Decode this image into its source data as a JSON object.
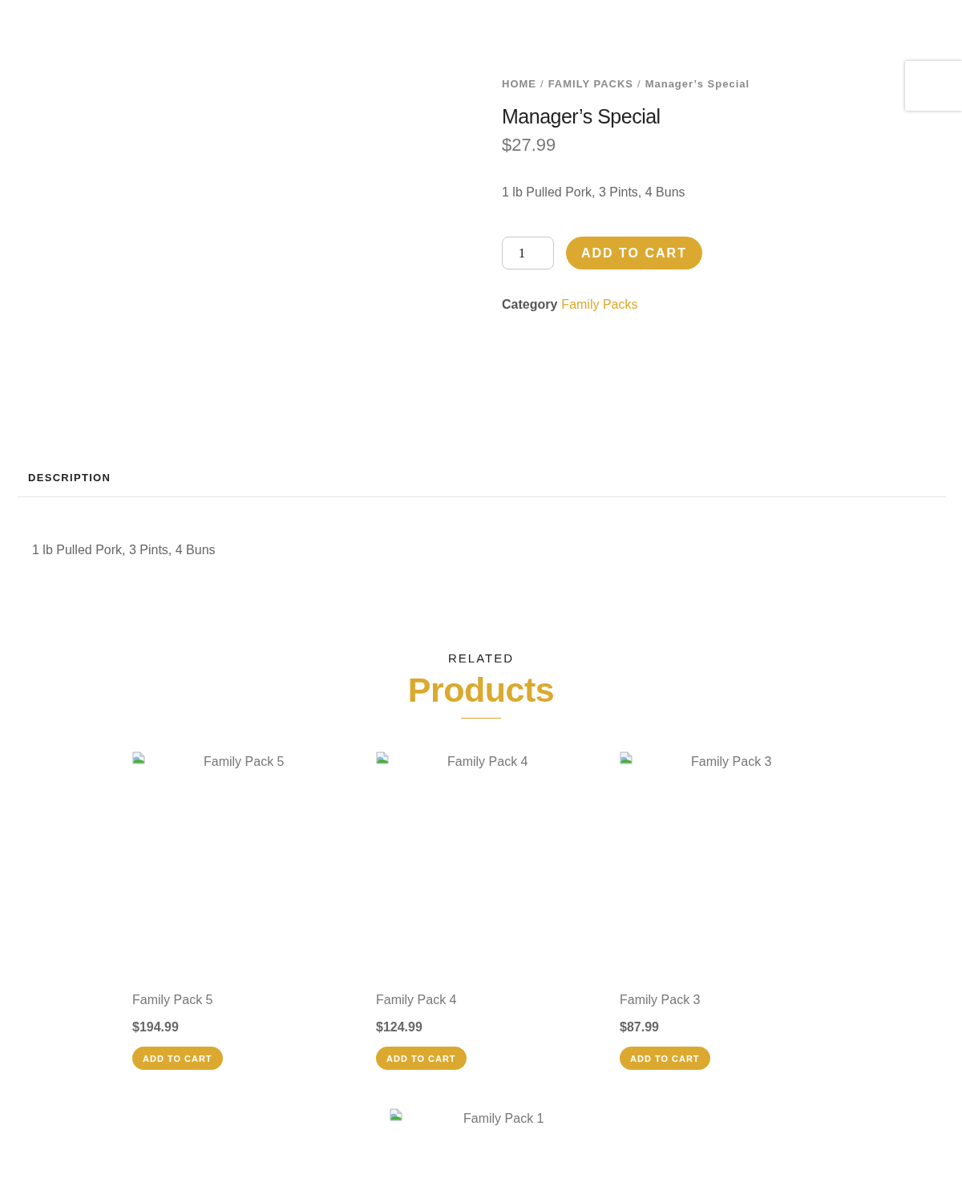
{
  "breadcrumb_separator": "/",
  "breadcrumb": [
    {
      "label": "HOME"
    },
    {
      "label": "FAMILY PACKS"
    },
    {
      "label": "Manager’s Special"
    }
  ],
  "product": {
    "title": "Manager’s Special",
    "price": "$27.99",
    "short_description": "1 lb Pulled Pork, 3 Pints, 4 Buns",
    "quantity": "1",
    "add_to_cart": "ADD TO CART",
    "category_label": "Category",
    "category_link": "Family Packs"
  },
  "tabs": [
    {
      "label": "DESCRIPTION",
      "selected": true
    }
  ],
  "description": {
    "text": "1 lb Pulled Pork, 3 Pints, 4 Buns"
  },
  "related": {
    "kicker": "RELATED",
    "heading": "Products",
    "products": [
      {
        "image_alt": "Family Pack 5",
        "name": "Family Pack 5",
        "price": "$194.99",
        "button": "ADD TO CART"
      },
      {
        "image_alt": "Family Pack 4",
        "name": "Family Pack 4",
        "price": "$124.99",
        "button": "ADD TO CART"
      },
      {
        "image_alt": "Family Pack 3",
        "name": "Family Pack 3",
        "price": "$87.99",
        "button": "ADD TO CART"
      },
      {
        "image_alt": "Family Pack 1"
      }
    ]
  }
}
